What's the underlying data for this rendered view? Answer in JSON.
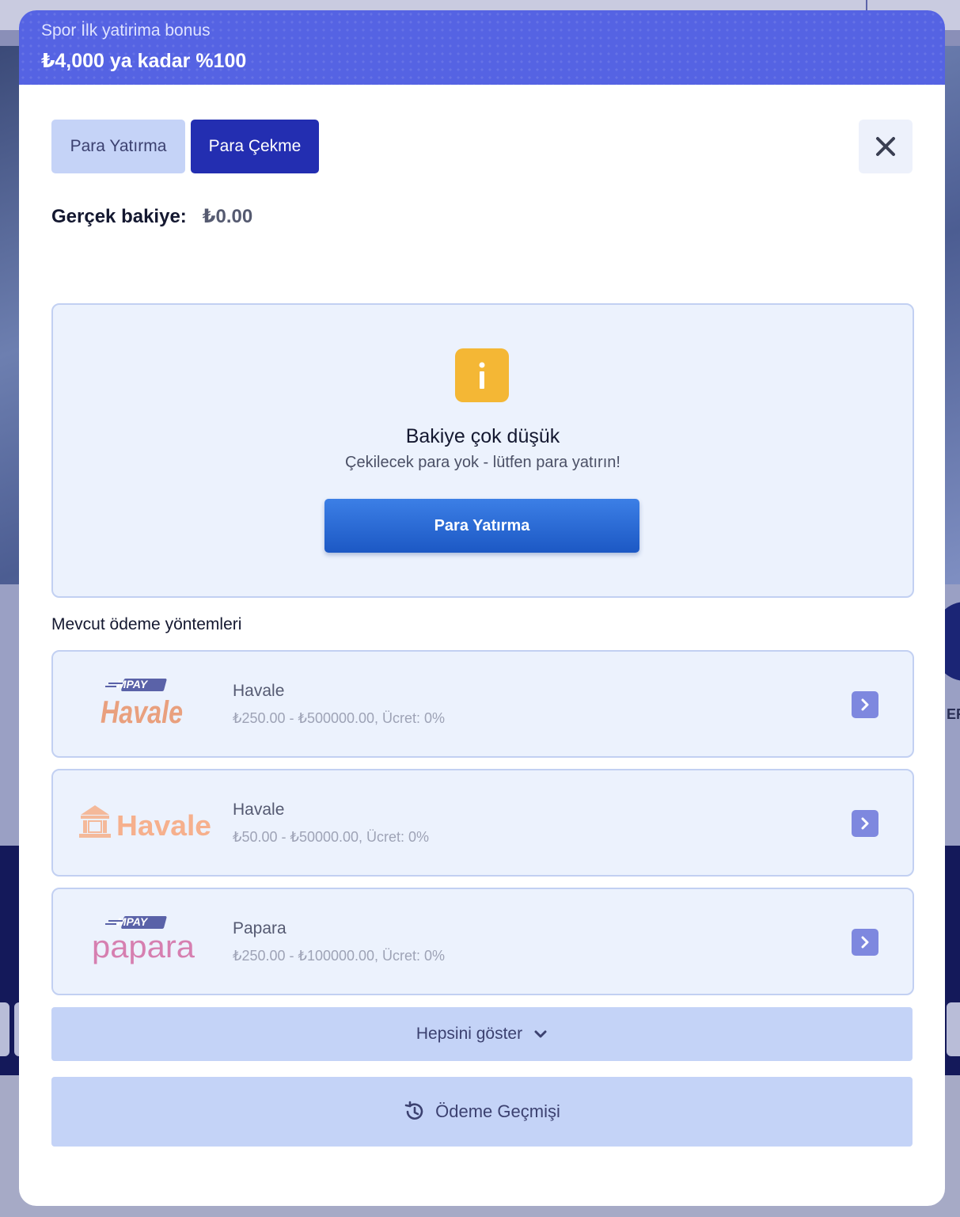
{
  "banner": {
    "subtitle": "Spor İlk yatirima bonus",
    "title": "₺4,000 ya kadar %100"
  },
  "tabs": {
    "deposit": "Para Yatırma",
    "withdraw": "Para Çekme",
    "active": "withdraw"
  },
  "balance": {
    "label": "Gerçek bakiye:",
    "value": "₺0.00"
  },
  "notice": {
    "icon": "info-icon",
    "title": "Bakiye çok düşük",
    "description": "Çekilecek para yok - lütfen para yatırın!",
    "button_label": "Para Yatırma"
  },
  "methods": {
    "title": "Mevcut ödeme yöntemleri",
    "items": [
      {
        "logo_text": "Havale",
        "logo_badge": "MPAY",
        "name": "Havale",
        "info": "₺250.00 - ₺500000.00, Ücret: 0%"
      },
      {
        "logo_text": "Havale",
        "logo_badge": "",
        "name": "Havale",
        "info": "₺50.00 - ₺50000.00, Ücret: 0%"
      },
      {
        "logo_text": "papara",
        "logo_badge": "MPAY",
        "name": "Papara",
        "info": "₺250.00 - ₺100000.00, Ücret: 0%"
      }
    ]
  },
  "show_all_label": "Hepsini göster",
  "history_label": "Ödeme Geçmişi",
  "background": {
    "side_text": "ERİ"
  },
  "colors": {
    "banner": "#5563e3",
    "tab_active": "#232eb1",
    "tab_inactive": "#c5d3f7",
    "warning": "#f4b735",
    "primary_button": "#1c58c4",
    "arrow": "#7e88df"
  }
}
